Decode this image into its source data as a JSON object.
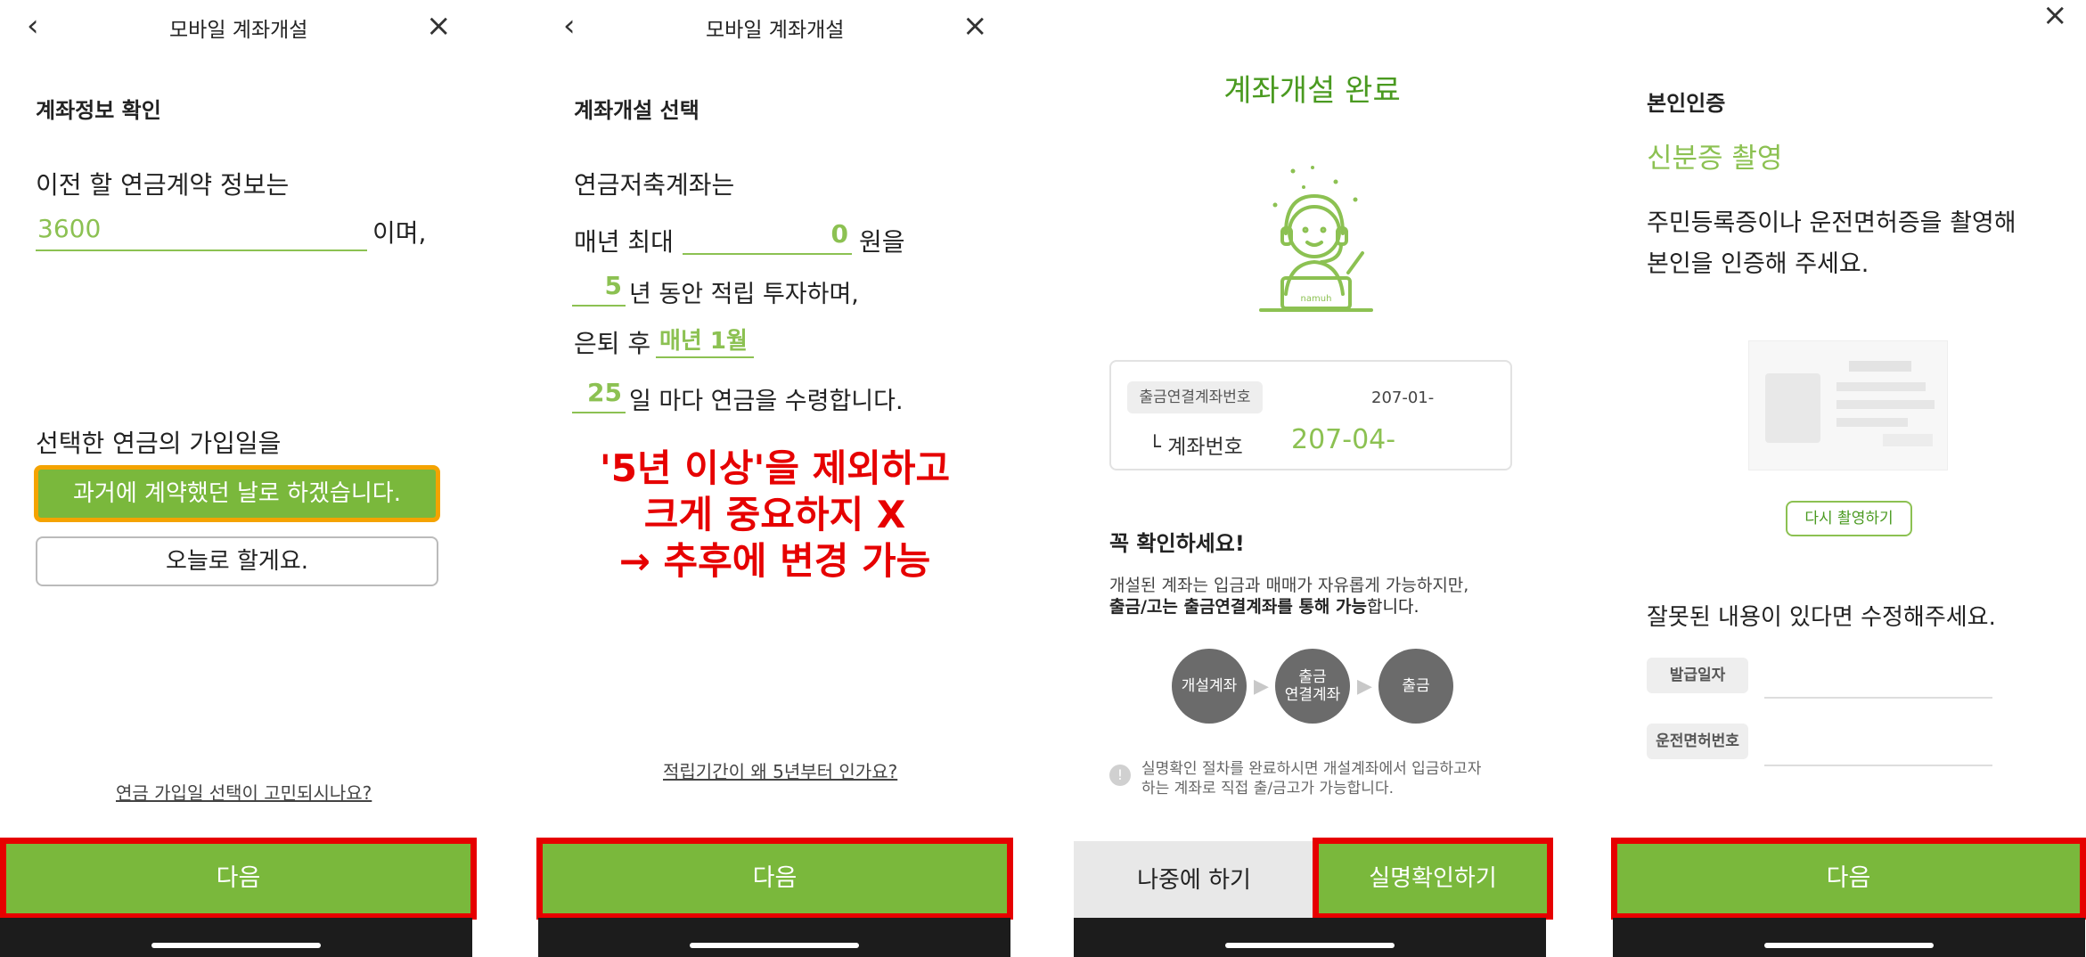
{
  "screen1": {
    "header_title": "모바일 계좌개설",
    "section_title": "계좌정보 확인",
    "prompt_line": "이전 할 연금계약 정보는",
    "amount_value": "3600",
    "amount_suffix": "이며,",
    "join_date_prompt": "선택한 연금의 가입일을",
    "option_past": "과거에 계약했던 날로 하겠습니다.",
    "option_today": "오늘로 할게요.",
    "help_link": "연금 가입일 선택이 고민되시나요?",
    "next_button": "다음"
  },
  "screen2": {
    "header_title": "모바일 계좌개설",
    "section_title": "계좌개설 선택",
    "line1": "연금저축계좌는",
    "max_prefix": "매년 최대",
    "max_value": "0",
    "max_suffix": "원을",
    "years_value": "5",
    "years_suffix": "년 동안 적립 투자하며,",
    "retire_prefix": "은퇴 후",
    "retire_value": "매년 1월",
    "day_value": "25",
    "day_suffix": "일 마다  연금을 수령합니다.",
    "annotation_line1": "'5년 이상'을 제외하고",
    "annotation_line2": "크게 중요하지 X",
    "annotation_line3": "→ 추후에 변경 가능",
    "help_link": "적립기간이 왜 5년부터 인가요?",
    "next_button": "다음"
  },
  "screen3": {
    "title": "계좌개설 완료",
    "logo_text": "namuh",
    "linked_account_label": "출금연결계좌번호",
    "linked_account_value": "207-01-",
    "account_label": "└ 계좌번호",
    "account_value": "207-04-",
    "notice_title": "꼭 확인하세요!",
    "notice_line1": "개설된 계좌는 입금과 매매가 자유롭게 가능하지만,",
    "notice_bold": "출금/고는 출금연결계좌를 통해 가능",
    "notice_tail": "합니다.",
    "flow_step1": "개설계좌",
    "flow_step2_a": "출금",
    "flow_step2_b": "연결계좌",
    "flow_step3": "출금",
    "info_line1": "실명확인 절차를 완료하시면 개설계좌에서 입금하고자",
    "info_line2": "하는 계좌로 직접 출/금고가 가능합니다.",
    "later_button": "나중에 하기",
    "verify_button": "실명확인하기"
  },
  "screen4": {
    "section_title": "본인인증",
    "subtitle": "신분증 촬영",
    "desc_line1": "주민등록증이나 운전면허증을 촬영해",
    "desc_line2": "본인을 인증해 주세요.",
    "retake_button": "다시 촬영하기",
    "edit_prompt": "잘못된 내용이 있다면 수정해주세요.",
    "issue_date_label": "발급일자",
    "license_no_label": "운전면허번호",
    "next_button": "다음"
  },
  "colors": {
    "brand_green": "#7ab83c",
    "light_green": "#8cc152",
    "highlight_orange": "#f4a300",
    "annotation_red": "#e60000"
  }
}
